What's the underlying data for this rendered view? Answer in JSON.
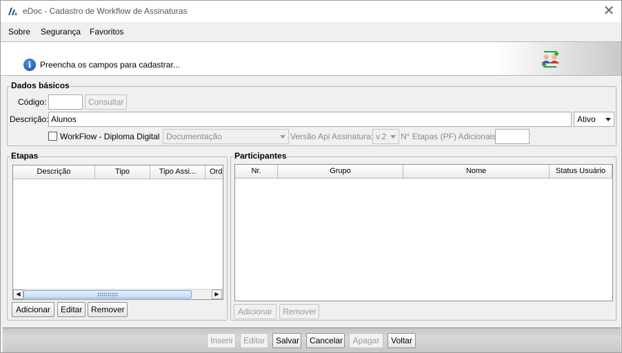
{
  "window": {
    "title": "eDoc - Cadastro de Workflow de Assinaturas"
  },
  "menu": {
    "items": [
      {
        "label": "Sobre"
      },
      {
        "label": "Segurança"
      },
      {
        "label": "Favoritos"
      }
    ]
  },
  "banner": {
    "message": "Preencha os campos para cadastrar..."
  },
  "dados_basicos": {
    "legend": "Dados básicos",
    "codigo_label": "Código:",
    "codigo_value": "",
    "consultar_button": "Consultar",
    "descricao_label": "Descrição:",
    "descricao_value": "Alunos",
    "status_value": "Ativo",
    "workflow_checkbox_label": "WorkFlow - Diploma Digital",
    "workflow_checked": false,
    "documentacao_value": "Documentação",
    "versao_label": "Versão Api Assinatura:",
    "versao_value": "v.2",
    "etapas_pf_label": "N° Etapas (PF) Adicionais:",
    "etapas_pf_value": ""
  },
  "etapas": {
    "legend": "Etapas",
    "columns": [
      "Descrição",
      "Tipo",
      "Tipo Assi...",
      "Ord"
    ],
    "rows": [],
    "buttons": {
      "adicionar": "Adicionar",
      "editar": "Editar",
      "remover": "Remover"
    }
  },
  "participantes": {
    "legend": "Participantes",
    "columns": [
      "Nr.",
      "Grupo",
      "Nome",
      "Status Usuário"
    ],
    "rows": [],
    "buttons": {
      "adicionar": "Adicionar",
      "remover": "Remover"
    }
  },
  "footer": {
    "inserir": "Inserir",
    "editar": "Editar",
    "salvar": "Salvar",
    "cancelar": "Cancelar",
    "apagar": "Apagar",
    "voltar": "Voltar"
  }
}
